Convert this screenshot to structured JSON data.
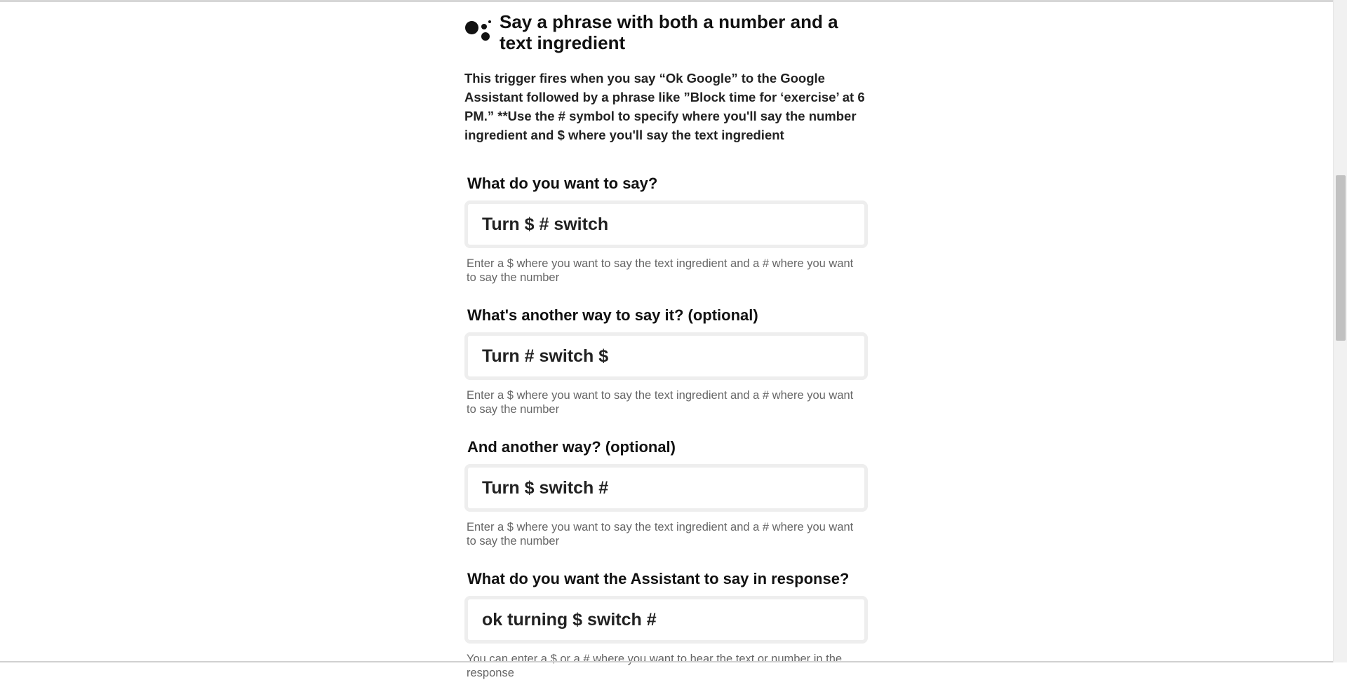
{
  "trigger": {
    "title": "Say a phrase with both a number and a text ingredient",
    "description": "This trigger fires when you say “Ok Google” to the Google Assistant followed by a phrase like ”Block time for ‘exercise’ at 6 PM.” **Use the # symbol to specify where you'll say the number ingredient and $ where you'll say the text ingredient",
    "icon": "google-assistant-icon"
  },
  "fields": [
    {
      "label": "What do you want to say?",
      "value": "Turn $ # switch",
      "help": "Enter a $ where you want to say the text ingredient and a # where you want to say the number"
    },
    {
      "label": "What's another way to say it? (optional)",
      "value": "Turn # switch $",
      "help": "Enter a $ where you want to say the text ingredient and a # where you want to say the number"
    },
    {
      "label": "And another way? (optional)",
      "value": "Turn $ switch #",
      "help": "Enter a $ where you want to say the text ingredient and a # where you want to say the number"
    },
    {
      "label": "What do you want the Assistant to say in response?",
      "value": "ok turning $ switch #",
      "help": "You can enter a $ or a # where you want to hear the text or number in the response"
    }
  ],
  "colors": {
    "text": "#222222",
    "help_text": "#666666",
    "input_border": "#eeeeee",
    "background": "#ffffff"
  }
}
